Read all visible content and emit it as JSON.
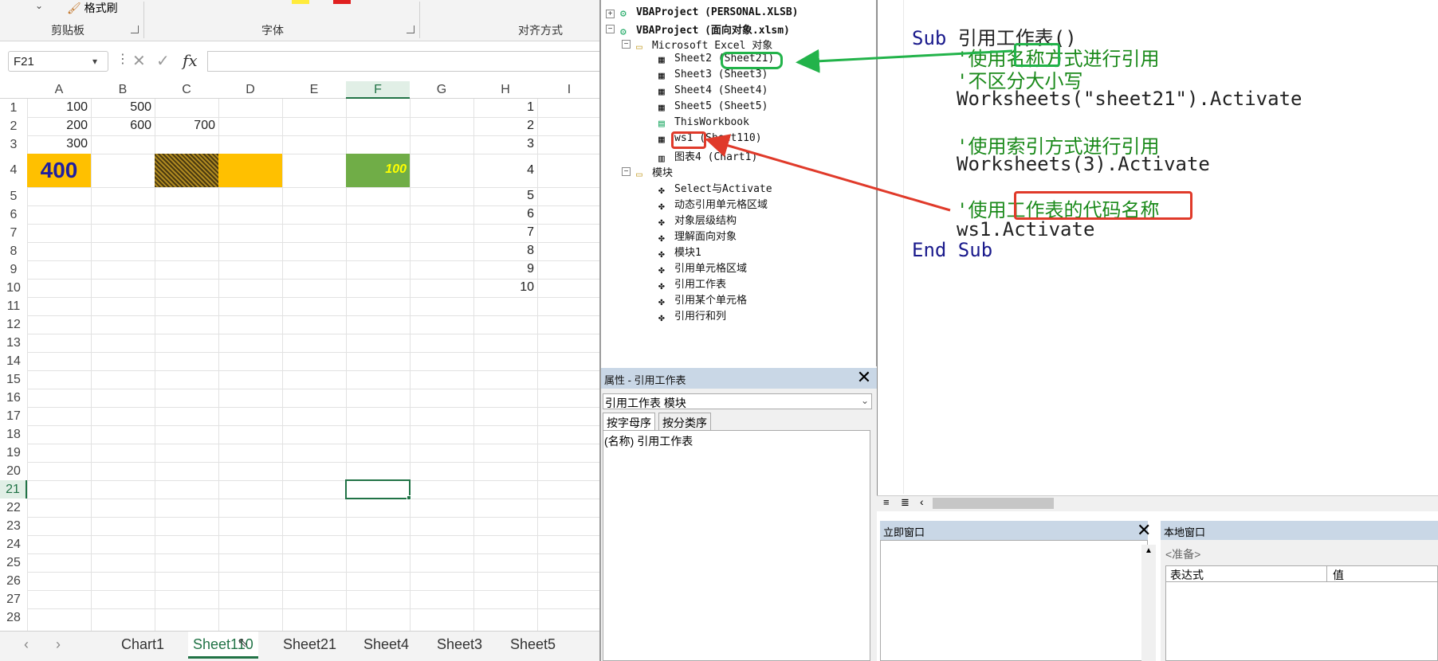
{
  "excel": {
    "ribbon": {
      "format_painter": "格式刷",
      "groups": [
        "剪贴板",
        "字体",
        "对齐方式"
      ],
      "colors": {
        "highlight": "#ffeb3b",
        "font_red": "#e02020"
      }
    },
    "formula_bar": {
      "name_box": "F21",
      "fx": "fx",
      "formula": ""
    },
    "columns": [
      "A",
      "B",
      "C",
      "D",
      "E",
      "F",
      "G",
      "H",
      "I"
    ],
    "selected_column": "F",
    "rows": [
      "1",
      "2",
      "3",
      "4",
      "5",
      "6",
      "7",
      "8",
      "9",
      "10",
      "11",
      "12",
      "13",
      "14",
      "15",
      "16",
      "17",
      "18",
      "19",
      "20",
      "21",
      "22",
      "23",
      "24",
      "25",
      "26",
      "27",
      "28"
    ],
    "selected_row": "21",
    "cells": {
      "A1": "100",
      "B1": "500",
      "H1": "1",
      "A2": "200",
      "B2": "600",
      "C2": "700",
      "H2": "2",
      "A3": "300",
      "H3": "3",
      "A4": "400",
      "F4": "100",
      "H4": "4",
      "H5": "5",
      "H6": "6",
      "H7": "7",
      "H8": "8",
      "H9": "9",
      "H10": "10"
    },
    "cell_colors": {
      "orange": "#ffc000",
      "green": "#70ad47",
      "blue_text": "#1f1fa0",
      "yellow_text": "#ffff00"
    },
    "sheet_tabs": [
      "Chart1",
      "Sheet110",
      "Sheet21",
      "Sheet4",
      "Sheet3",
      "Sheet5"
    ],
    "active_tab": "Sheet110"
  },
  "vbe": {
    "project": {
      "nodes": [
        "VBAProject (PERSONAL.XLSB)",
        "VBAProject (面向对象.xlsm)",
        "Microsoft Excel 对象",
        "Sheet2 (Sheet21)",
        "Sheet3 (Sheet3)",
        "Sheet4 (Sheet4)",
        "Sheet5 (Sheet5)",
        "ThisWorkbook",
        "ws1 (Sheet110)",
        "图表4 (Chart1)",
        "模块",
        "Select与Activate",
        "动态引用单元格区域",
        "对象层级结构",
        "理解面向对象",
        "模块1",
        "引用单元格区域",
        "引用工作表",
        "引用某个单元格",
        "引用行和列"
      ]
    },
    "properties": {
      "title": "属性 - 引用工作表",
      "object": "引用工作表 模块",
      "tabs": [
        "按字母序",
        "按分类序"
      ],
      "row_name": "(名称)",
      "row_value": "引用工作表"
    },
    "code": {
      "lines": [
        {
          "kw": "Sub ",
          "tx": "引用工作表()"
        },
        {
          "cm": "'使用名称方式进行引用"
        },
        {
          "cm": "'不区分大小写"
        },
        {
          "tx": "Worksheets(\"sheet21\").Activate"
        },
        {
          "cm": "'使用索引方式进行引用"
        },
        {
          "tx": "Worksheets(3).Activate"
        },
        {
          "cm": "'使用工作表的代码名称"
        },
        {
          "tx": "ws1.Activate"
        },
        {
          "kw": "End Sub"
        }
      ]
    },
    "immediate": {
      "title": "立即窗口"
    },
    "locals": {
      "title": "本地窗口",
      "status": "<准备>",
      "col_expr": "表达式",
      "col_val": "值"
    },
    "annotation_colors": {
      "green": "#22b34a",
      "red": "#e03a2a"
    }
  }
}
